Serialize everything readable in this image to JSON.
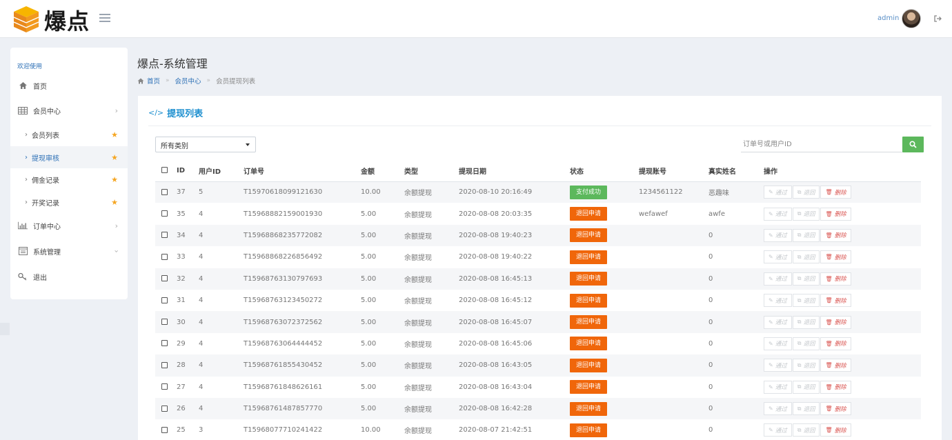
{
  "header": {
    "brand": "爆点",
    "user": "admin"
  },
  "sidebar": {
    "welcome": "欢迎使用",
    "items": [
      {
        "label": "首页",
        "icon": "home-icon"
      },
      {
        "label": "会员中心",
        "icon": "grid-icon"
      },
      {
        "label": "会员列表",
        "sub": true,
        "starred": true
      },
      {
        "label": "提现审核",
        "sub": true,
        "starred": true,
        "active": true
      },
      {
        "label": "佣金记录",
        "sub": true,
        "starred": true
      },
      {
        "label": "开奖记录",
        "sub": true,
        "starred": true
      },
      {
        "label": "订单中心",
        "icon": "bar-chart-icon"
      },
      {
        "label": "系统管理",
        "icon": "window-icon"
      },
      {
        "label": "退出",
        "icon": "key-icon"
      }
    ]
  },
  "page": {
    "title": "爆点-系统管理",
    "breadcrumb": [
      "首页",
      "会员中心",
      "会员提现列表"
    ]
  },
  "panel": {
    "title": "提现列表",
    "filter_selected": "所有类别",
    "search_placeholder": "订单号或用户ID"
  },
  "table": {
    "headers": [
      "ID",
      "用户ID",
      "订单号",
      "金额",
      "类型",
      "提现日期",
      "状态",
      "提现账号",
      "真实姓名",
      "操作"
    ],
    "action_labels": {
      "approve": "通过",
      "reject": "退回",
      "delete": "删除"
    },
    "rows": [
      {
        "id": "37",
        "user_id": "5",
        "order": "T15970618099121630",
        "amount": "10.00",
        "type": "余额提现",
        "date": "2020-08-10 20:16:49",
        "status": "支付成功",
        "status_kind": "success",
        "account": "1234561122",
        "name": "恶趣味"
      },
      {
        "id": "35",
        "user_id": "4",
        "order": "T15968882159001930",
        "amount": "5.00",
        "type": "余额提现",
        "date": "2020-08-08 20:03:35",
        "status": "退回申请",
        "status_kind": "pending",
        "account": "wefawef",
        "name": "awfe"
      },
      {
        "id": "34",
        "user_id": "4",
        "order": "T15968868235772082",
        "amount": "5.00",
        "type": "余额提现",
        "date": "2020-08-08 19:40:23",
        "status": "退回申请",
        "status_kind": "pending",
        "account": "",
        "name": "0"
      },
      {
        "id": "33",
        "user_id": "4",
        "order": "T15968868226856492",
        "amount": "5.00",
        "type": "余额提现",
        "date": "2020-08-08 19:40:22",
        "status": "退回申请",
        "status_kind": "pending",
        "account": "",
        "name": "0"
      },
      {
        "id": "32",
        "user_id": "4",
        "order": "T15968763130797693",
        "amount": "5.00",
        "type": "余额提现",
        "date": "2020-08-08 16:45:13",
        "status": "退回申请",
        "status_kind": "pending",
        "account": "",
        "name": "0"
      },
      {
        "id": "31",
        "user_id": "4",
        "order": "T15968763123450272",
        "amount": "5.00",
        "type": "余额提现",
        "date": "2020-08-08 16:45:12",
        "status": "退回申请",
        "status_kind": "pending",
        "account": "",
        "name": "0"
      },
      {
        "id": "30",
        "user_id": "4",
        "order": "T15968763072372562",
        "amount": "5.00",
        "type": "余额提现",
        "date": "2020-08-08 16:45:07",
        "status": "退回申请",
        "status_kind": "pending",
        "account": "",
        "name": "0"
      },
      {
        "id": "29",
        "user_id": "4",
        "order": "T15968763064444452",
        "amount": "5.00",
        "type": "余额提现",
        "date": "2020-08-08 16:45:06",
        "status": "退回申请",
        "status_kind": "pending",
        "account": "",
        "name": "0"
      },
      {
        "id": "28",
        "user_id": "4",
        "order": "T15968761855430452",
        "amount": "5.00",
        "type": "余额提现",
        "date": "2020-08-08 16:43:05",
        "status": "退回申请",
        "status_kind": "pending",
        "account": "",
        "name": "0"
      },
      {
        "id": "27",
        "user_id": "4",
        "order": "T15968761848626161",
        "amount": "5.00",
        "type": "余额提现",
        "date": "2020-08-08 16:43:04",
        "status": "退回申请",
        "status_kind": "pending",
        "account": "",
        "name": "0"
      },
      {
        "id": "26",
        "user_id": "4",
        "order": "T15968761487857770",
        "amount": "5.00",
        "type": "余额提现",
        "date": "2020-08-08 16:42:28",
        "status": "退回申请",
        "status_kind": "pending",
        "account": "",
        "name": "0"
      },
      {
        "id": "25",
        "user_id": "3",
        "order": "T15968077710241422",
        "amount": "10.00",
        "type": "余额提现",
        "date": "2020-08-07 21:42:51",
        "status": "退回申请",
        "status_kind": "pending",
        "account": "",
        "name": "0"
      }
    ]
  },
  "colors": {
    "accent_blue": "#2a6eb5",
    "panel_title": "#1d8fcf",
    "success_green": "#5cb85c",
    "pending_orange": "#f0660a",
    "delete_red": "#d9534f",
    "star_gold": "#f5a623"
  }
}
